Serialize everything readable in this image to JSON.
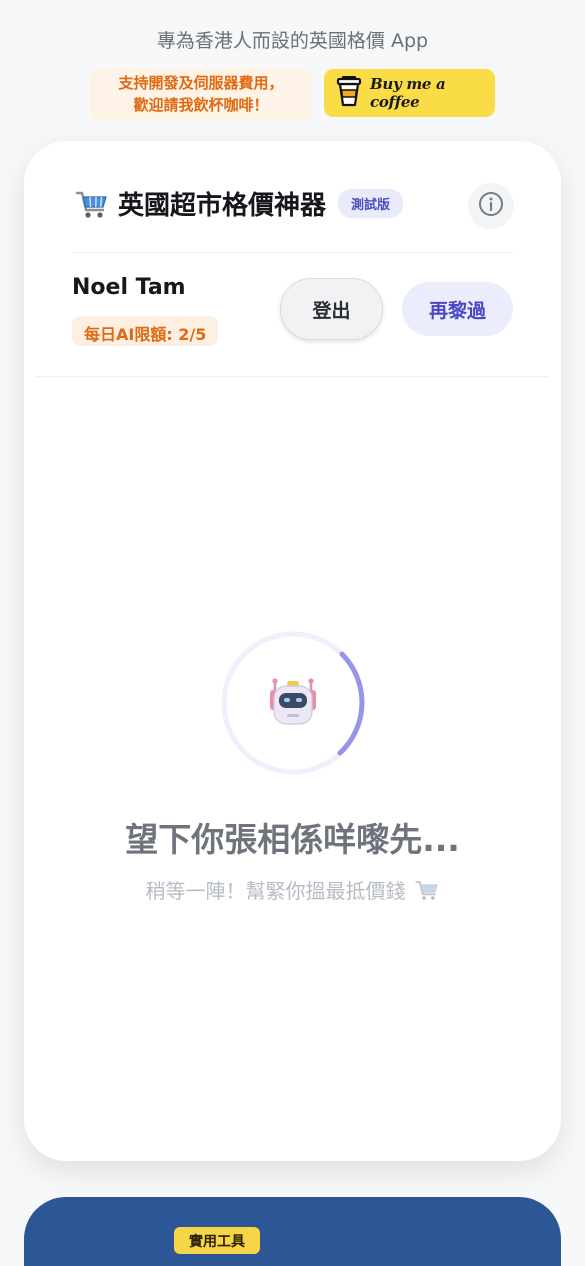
{
  "header": {
    "tagline": "專為香港人而設的英國格價 App",
    "support_note_line1": "支持開發及伺服器費用，",
    "support_note_line2": "歡迎請我飲杯咖啡！",
    "coffee_button_label": "Buy me a coffee",
    "coffee_icon": "coffee-cup-icon"
  },
  "card": {
    "title_icon": "shopping-cart-icon",
    "title": "英國超市格價神器",
    "beta_badge": "測試版",
    "info_icon": "info-icon",
    "user": {
      "name": "Noel Tam",
      "quota": "每日AI限額: 2/5"
    },
    "buttons": {
      "logout": "登出",
      "retry": "再黎過"
    },
    "loading": {
      "icon": "robot-icon",
      "title": "望下你張相係咩嚟先...",
      "subtitle": "稍等一陣！幫緊你搵最抵價錢",
      "subtitle_icon": "shopping-cart-icon"
    }
  },
  "bottom_section": {
    "badge": "實用工具"
  },
  "colors": {
    "accent": "#4a47c4",
    "warning_orange": "#e06a12",
    "coffee_yellow": "#fadc46",
    "bottom_blue": "#2d5697"
  }
}
